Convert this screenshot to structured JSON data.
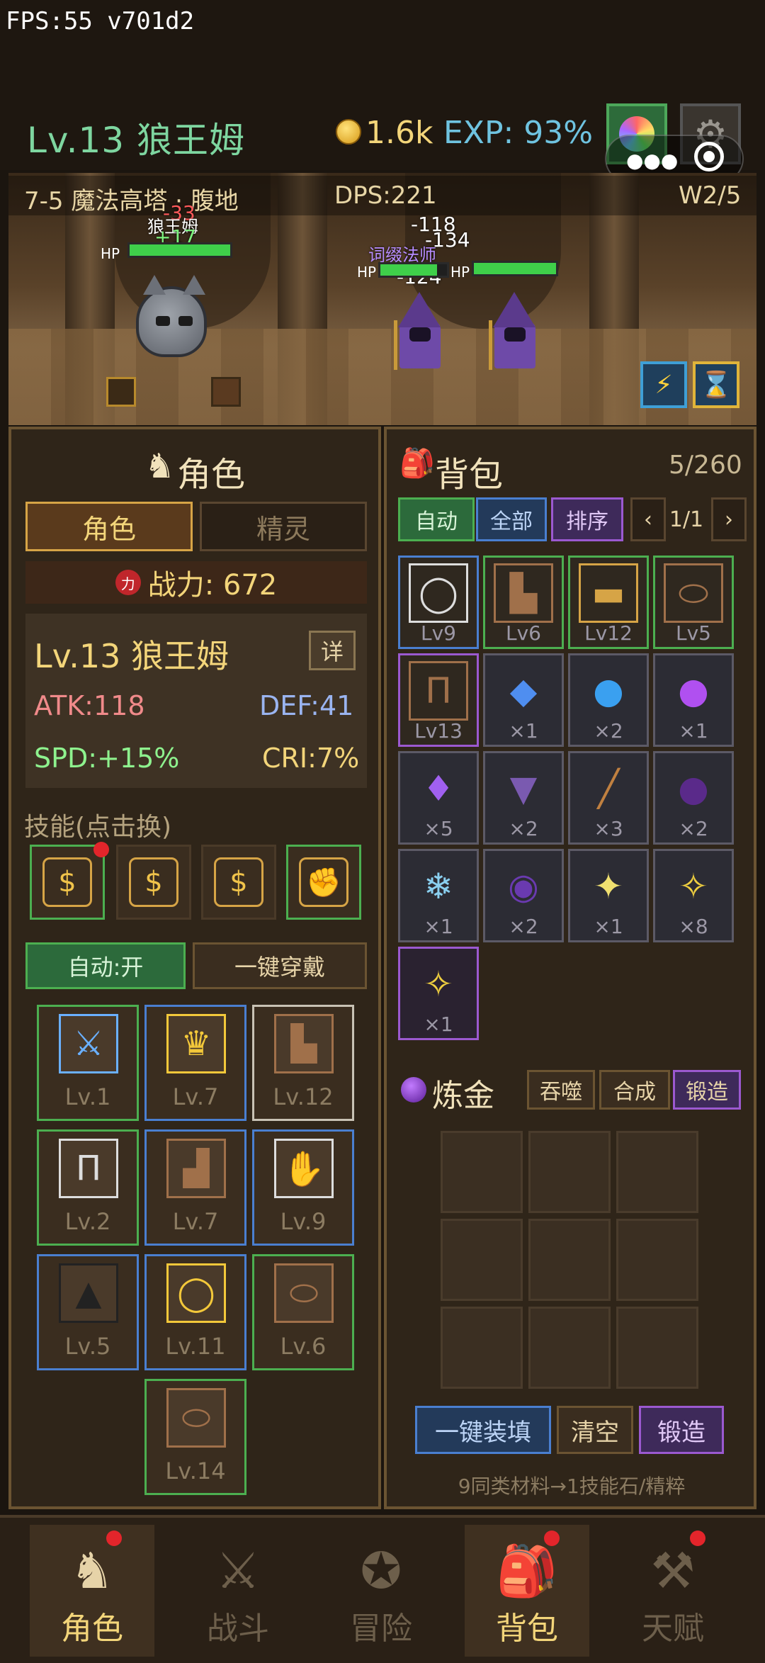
{
  "fps": "FPS:55 v701d2",
  "header": {
    "level_name": "Lv.13 狼王姆",
    "gold": "1.6k",
    "exp": "EXP: 93%"
  },
  "battle": {
    "stage": "7-5 魔法高塔 · 腹地",
    "dps": "DPS:221",
    "wave": "W2/5",
    "player_label": "狼王姆",
    "enemy_label": "词缀法师",
    "hp": "HP",
    "dmg": [
      "-33",
      "+17",
      "-118",
      "-134",
      "-124"
    ],
    "player_hp": 1.0,
    "enemy_hp": [
      0.85,
      1.0
    ]
  },
  "character": {
    "title": "角色",
    "tabs": [
      "角色",
      "精灵"
    ],
    "power": "战力: 672",
    "power_icon": "力",
    "name": "Lv.13 狼王姆",
    "detail": "详",
    "atk": "ATK:118",
    "def": "DEF:41",
    "spd": "SPD:+15%",
    "cri": "CRI:7%",
    "skills_label": "技能(点击换)",
    "auto": "自动:开",
    "equip_all": "一键穿戴",
    "equipment": [
      {
        "icon": "sword-icon",
        "lv": "Lv.1"
      },
      {
        "icon": "crown-icon",
        "lv": "Lv.7"
      },
      {
        "icon": "armor-icon",
        "lv": "Lv.12"
      },
      {
        "icon": "pants-icon",
        "lv": "Lv.2"
      },
      {
        "icon": "boots-icon",
        "lv": "Lv.7"
      },
      {
        "icon": "gloves-icon",
        "lv": "Lv.9"
      },
      {
        "icon": "cloak-icon",
        "lv": "Lv.5"
      },
      {
        "icon": "necklace-icon",
        "lv": "Lv.11"
      },
      {
        "icon": "ring-icon",
        "lv": "Lv.6"
      },
      {
        "icon": "ring-icon",
        "lv": "Lv.14"
      }
    ]
  },
  "backpack": {
    "title": "背包",
    "count": "5/260",
    "buttons": [
      "自动",
      "全部",
      "排序"
    ],
    "page": "1/1",
    "items": [
      {
        "icon": "necklace-icon",
        "label": "Lv9"
      },
      {
        "icon": "armor-icon",
        "label": "Lv6"
      },
      {
        "icon": "belt-icon",
        "label": "Lv12"
      },
      {
        "icon": "ring-icon",
        "label": "Lv5"
      },
      {
        "icon": "pants-icon",
        "label": "Lv13"
      },
      {
        "icon": "blue-crystal-icon",
        "label": "×1"
      },
      {
        "icon": "blue-orb-icon",
        "label": "×2"
      },
      {
        "icon": "purple-orb-icon",
        "label": "×1"
      },
      {
        "icon": "purple-crystal-icon",
        "label": "×5"
      },
      {
        "icon": "wolf-head-icon",
        "label": "×2"
      },
      {
        "icon": "wand-icon",
        "label": "×3"
      },
      {
        "icon": "dark-orb-icon",
        "label": "×2"
      },
      {
        "icon": "ice-shard-icon",
        "label": "×1"
      },
      {
        "icon": "vortex-icon",
        "label": "×2"
      },
      {
        "icon": "sparkle-icon",
        "label": "×1"
      },
      {
        "icon": "magic-wand-icon",
        "label": "×8"
      },
      {
        "icon": "magic-wand-icon",
        "label": "×1"
      }
    ]
  },
  "alchemy": {
    "title": "炼金",
    "modes": [
      "吞噬",
      "合成",
      "锻造"
    ],
    "fill": "一键装填",
    "clear": "清空",
    "forge": "锻造",
    "hint": "9同类材料→1技能石/精粹"
  },
  "nav": [
    "角色",
    "战斗",
    "冒险",
    "背包",
    "天赋"
  ]
}
